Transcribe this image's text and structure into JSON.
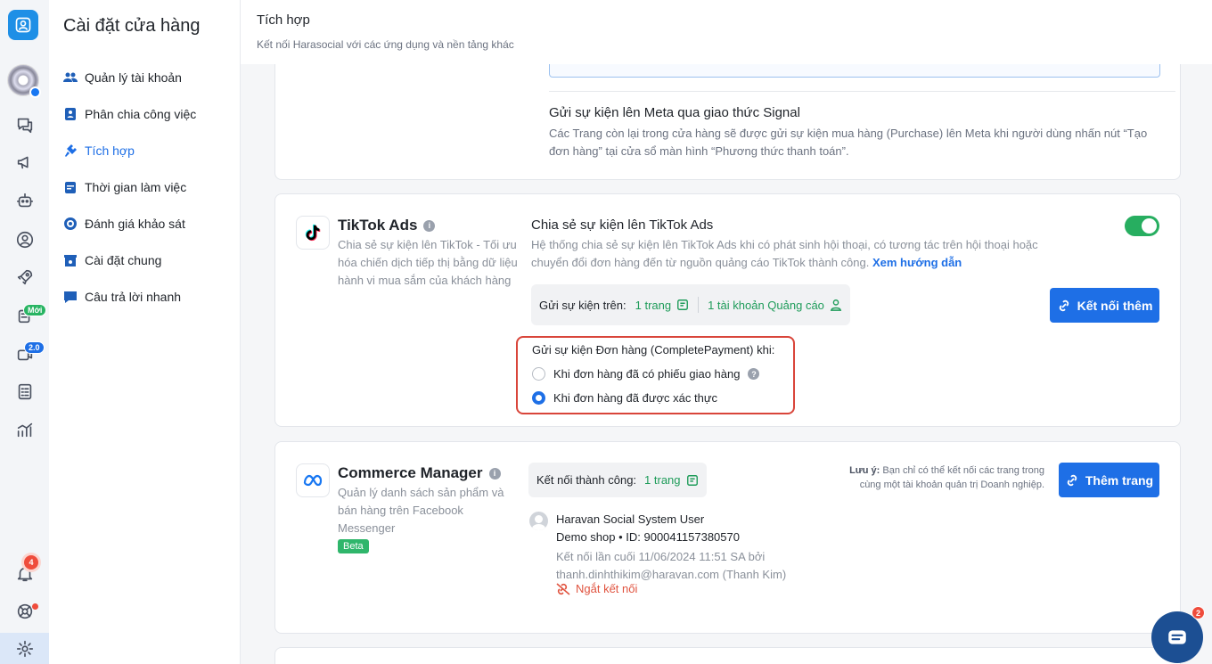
{
  "rail": {
    "icons": [
      "logo-icon",
      "avatar",
      "chat-icon",
      "megaphone-icon",
      "bot-icon",
      "user-circle-icon",
      "rocket-icon",
      "clipboard-icon",
      "video-icon",
      "checklist-icon",
      "analytics-icon",
      "bell-icon",
      "lifebuoy-icon",
      "gear-icon"
    ],
    "new_badge": "Mới",
    "version_badge": "2.0",
    "notif_count": "4"
  },
  "sidebar": {
    "title": "Cài đặt cửa hàng",
    "items": [
      {
        "label": "Quản lý tài khoản",
        "icon": "users-icon"
      },
      {
        "label": "Phân chia công việc",
        "icon": "id-card-icon"
      },
      {
        "label": "Tích hợp",
        "icon": "plug-icon",
        "active": true
      },
      {
        "label": "Thời gian làm việc",
        "icon": "calendar-icon"
      },
      {
        "label": "Đánh giá khảo sát",
        "icon": "survey-icon"
      },
      {
        "label": "Cài đặt chung",
        "icon": "store-settings-icon"
      },
      {
        "label": "Câu trả lời nhanh",
        "icon": "quick-reply-icon"
      }
    ]
  },
  "header": {
    "title": "Tích hợp",
    "subtitle": "Kết nối Harasocial với các ứng dụng và nền tảng khác"
  },
  "meta_signal": {
    "title": "Gửi sự kiện lên Meta qua giao thức Signal",
    "desc": "Các Trang còn lại trong cửa hàng sẽ được gửi sự kiện mua hàng (Purchase) lên Meta khi người dùng nhấn nút “Tạo đơn hàng” tại cửa sổ màn hình “Phương thức thanh toán”."
  },
  "tiktok": {
    "name": "TikTok Ads",
    "desc": "Chia sẻ sự kiện lên TikTok - Tối ưu hóa chiến dịch tiếp thị bằng dữ liệu hành vi mua sắm của khách hàng",
    "feature_title": "Chia sẻ sự kiện lên TikTok Ads",
    "feature_desc": "Hệ thống chia sẻ sự kiện lên TikTok Ads khi có phát sinh hội thoại, có tương tác trên hội thoại hoặc chuyển đổi đơn hàng đến từ nguồn quảng cáo TikTok thành công.",
    "guide_link": "Xem hướng dẫn",
    "enabled": true,
    "send_on_label": "Gửi sự kiện trên:",
    "pages": "1 trang",
    "ad_accounts": "1 tài khoản Quảng cáo",
    "connect_more": "Kết nối thêm",
    "event_title": "Gửi sự kiện Đơn hàng (CompletePayment) khi:",
    "options": [
      {
        "label": "Khi đơn hàng đã có phiếu giao hàng",
        "selected": false
      },
      {
        "label": "Khi đơn hàng đã được xác thực",
        "selected": true
      }
    ]
  },
  "commerce": {
    "name": "Commerce Manager",
    "desc": "Quản lý danh sách sản phẩm và bán hàng trên Facebook Messenger",
    "beta": "Beta",
    "connected_label": "Kết nối thành công:",
    "pages": "1 trang",
    "note_label": "Lưu ý:",
    "note": "Bạn chỉ có thể kết nối các trang trong cùng một tài khoản quản trị Doanh nghiệp.",
    "add_page": "Thêm trang",
    "user_name": "Haravan Social System User",
    "shop": "Demo shop • ID: 900041157380570",
    "last_connected": "Kết nối lần cuối 11/06/2024 11:51 SA bởi thanh.dinhthikim@haravan.com (Thanh Kim)",
    "disconnect": "Ngắt kết nối"
  },
  "chat": {
    "badge": "2"
  },
  "colors": {
    "primary": "#1e6fe6",
    "success": "#27ae60",
    "danger": "#d9453a"
  }
}
